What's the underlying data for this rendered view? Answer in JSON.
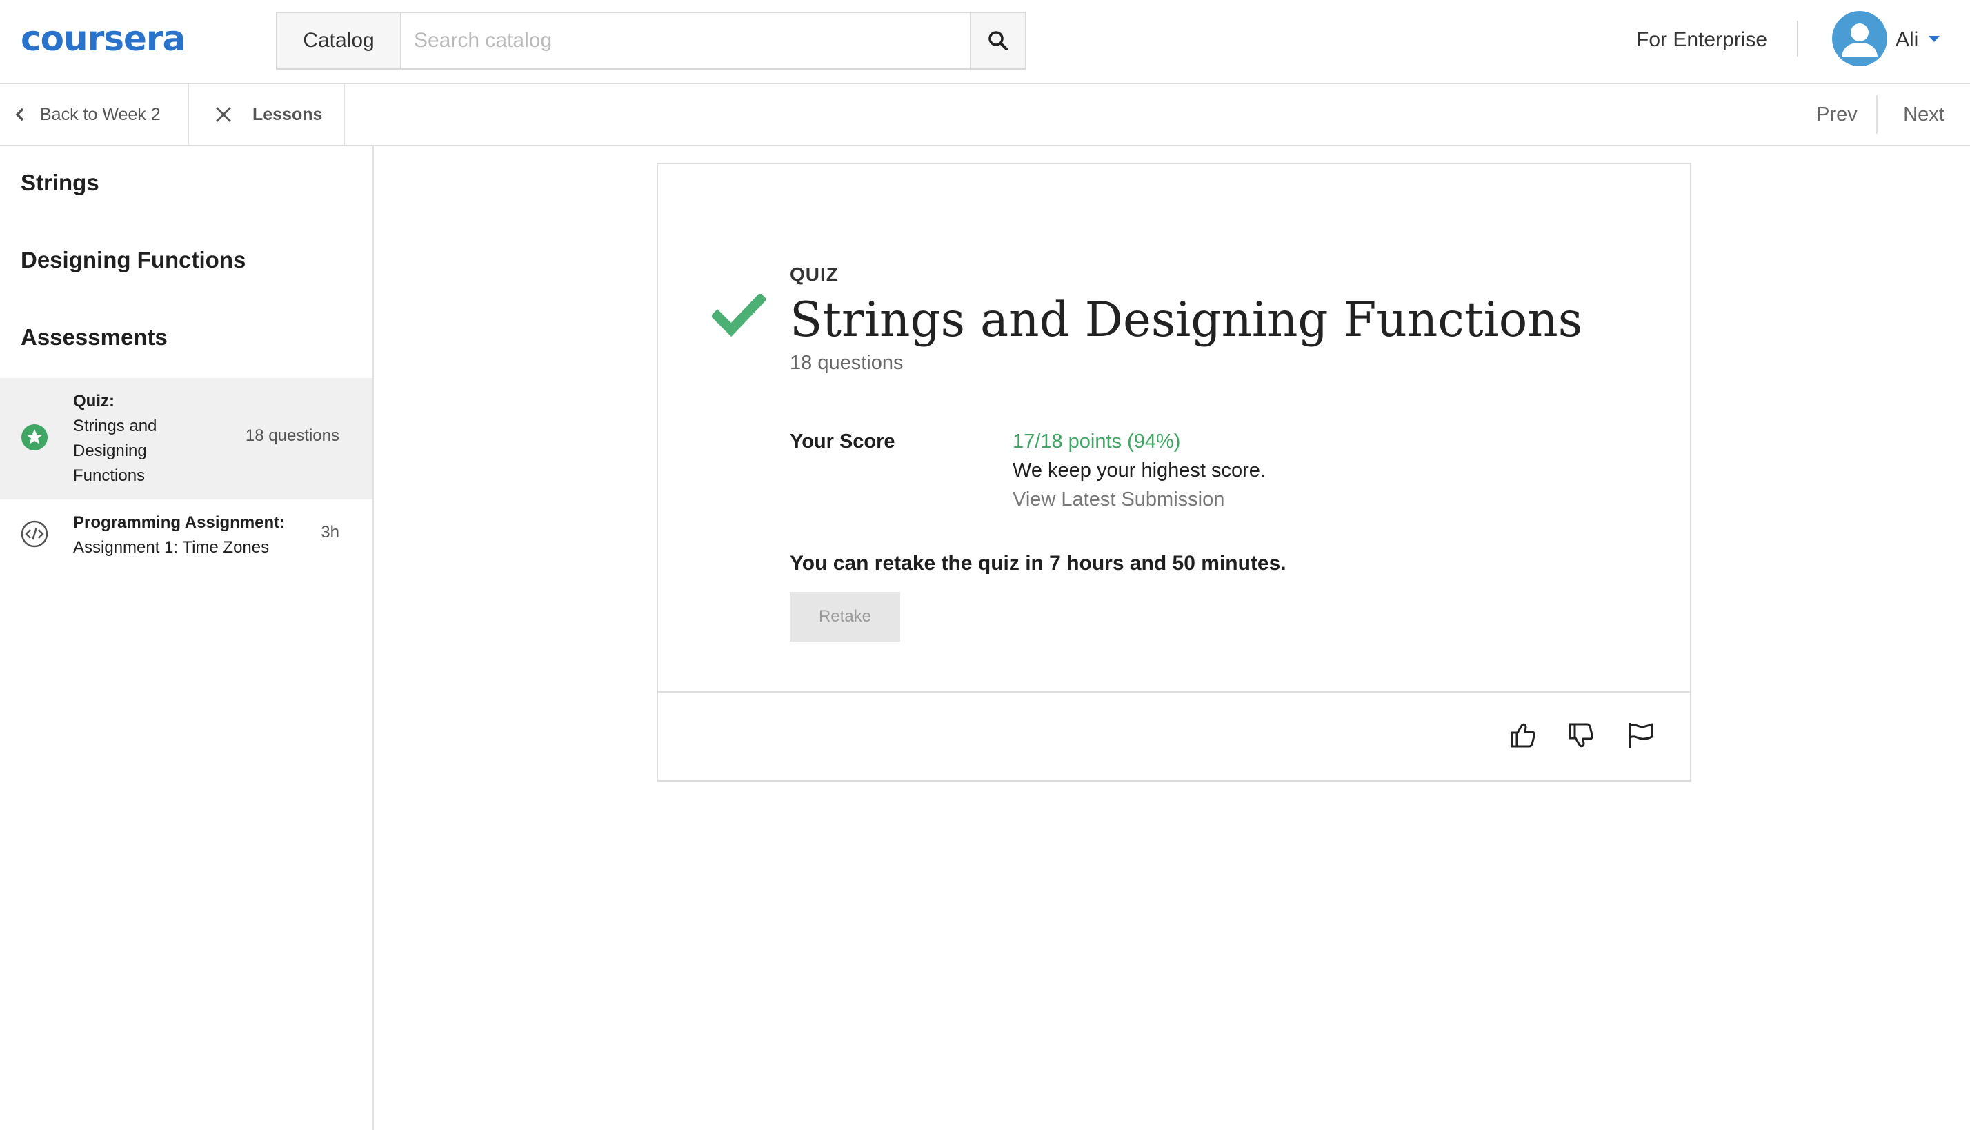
{
  "header": {
    "logo": "coursera",
    "catalog_label": "Catalog",
    "search_placeholder": "Search catalog",
    "enterprise_label": "For Enterprise",
    "user_name": "Ali"
  },
  "subnav": {
    "back_label": "Back to Week 2",
    "lessons_label": "Lessons",
    "prev_label": "Prev",
    "next_label": "Next"
  },
  "sidebar": {
    "sections": [
      "Strings",
      "Designing Functions",
      "Assessments"
    ],
    "items": [
      {
        "kind": "Quiz:",
        "title_lines": [
          "Strings and",
          "Designing",
          "Functions"
        ],
        "meta": "18 questions",
        "icon": "star-badge-icon",
        "active": true
      },
      {
        "kind": "Programming Assignment:",
        "title_lines": [
          "Assignment 1: Time Zones"
        ],
        "meta": "3h",
        "icon": "code-icon",
        "active": false
      }
    ]
  },
  "quiz": {
    "label": "QUIZ",
    "title": "Strings and Designing Functions",
    "question_count": "18 questions",
    "score_label": "Your Score",
    "score_value": "17/18 points (94%)",
    "score_note": "We keep your highest score.",
    "view_submission": "View Latest Submission",
    "retake_message": "You can retake the quiz in 7 hours and 50 minutes.",
    "retake_button": "Retake"
  },
  "colors": {
    "brand": "#2a73cc",
    "success": "#3fa663",
    "check": "#4caf73"
  },
  "feedback_icons": [
    "thumbs-up-icon",
    "thumbs-down-icon",
    "flag-icon"
  ]
}
